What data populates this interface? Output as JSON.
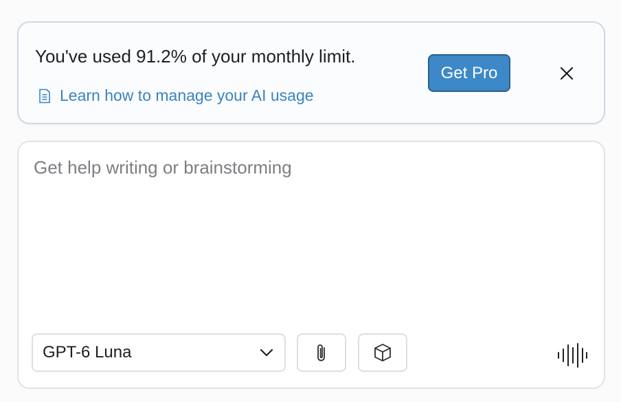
{
  "banner": {
    "message": "You've used 91.2% of your monthly limit.",
    "usage_percent": 91.2,
    "link_label": "Learn how to manage your AI usage",
    "link_icon": "document-icon",
    "cta_label": "Get Pro",
    "close_icon": "close-icon",
    "accent_color": "#3d88c8",
    "link_color": "#3a83bf"
  },
  "composer": {
    "placeholder": "Get help writing or brainstorming",
    "value": "",
    "model": {
      "selected": "GPT-6 Luna",
      "icon": "chevron-down-icon"
    },
    "tools": [
      {
        "name": "attach",
        "icon": "paperclip-icon"
      },
      {
        "name": "cube",
        "icon": "cube-icon"
      }
    ],
    "voice_icon": "waveform-icon"
  }
}
